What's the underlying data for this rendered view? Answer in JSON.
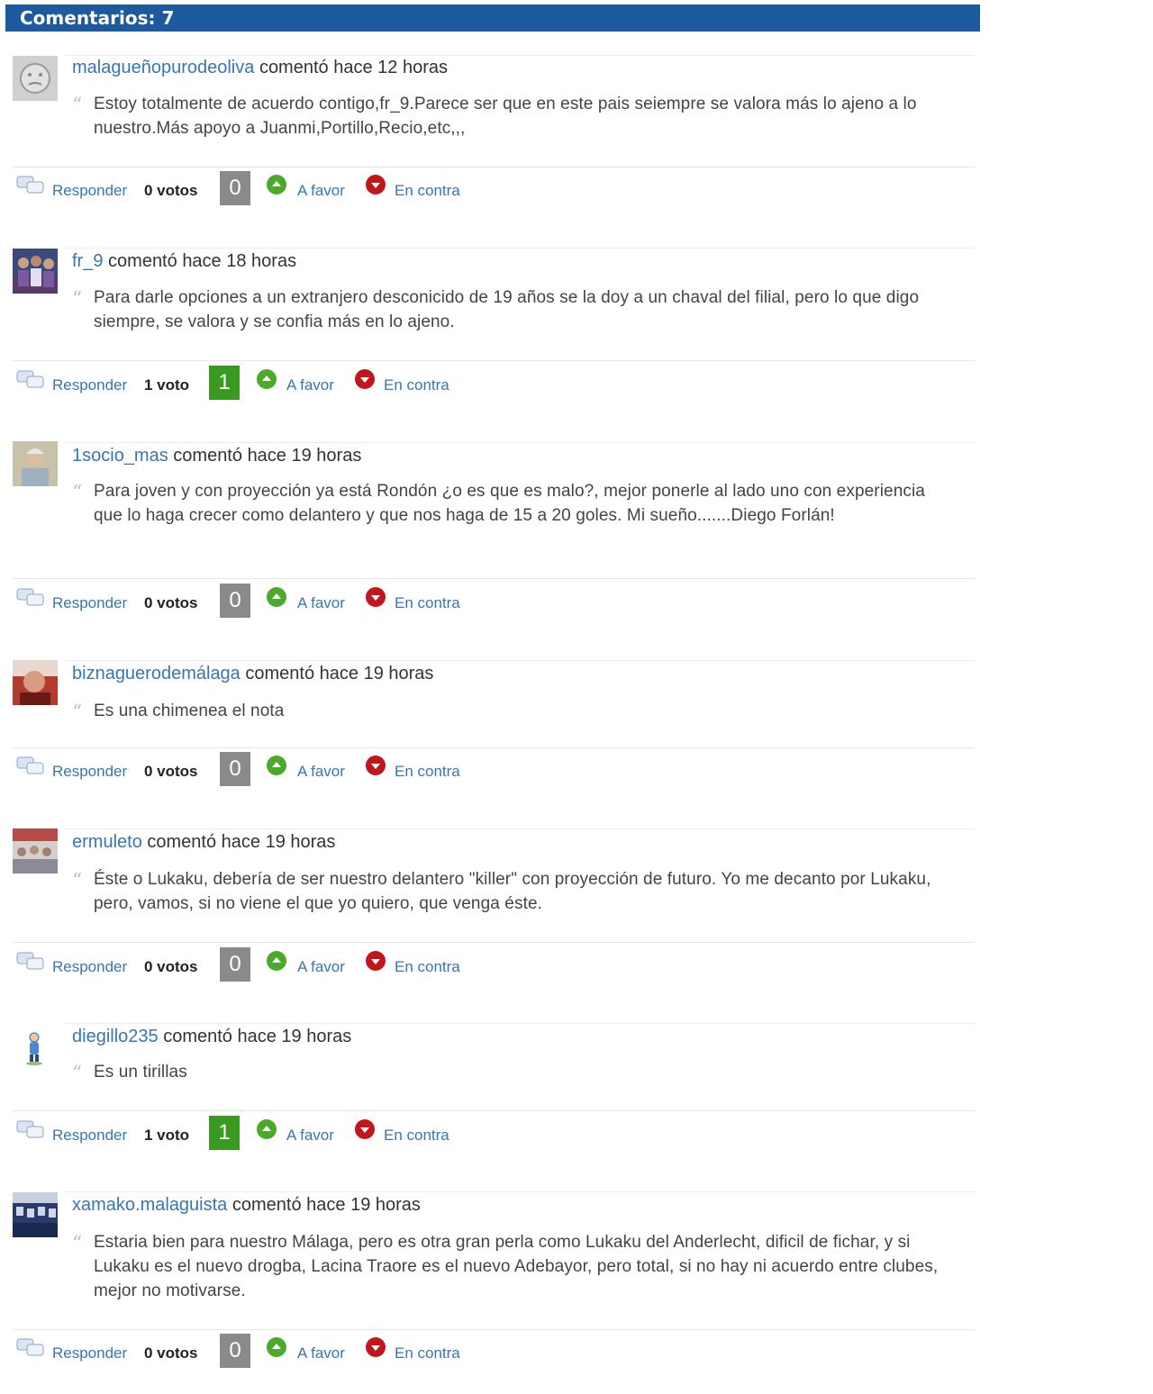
{
  "header": {
    "title": "Comentarios: 7"
  },
  "colors": {
    "header_bg": "#1b5a9e",
    "link": "#3776b5",
    "score_zero": "#8a8a8a",
    "score_positive": "#3a9a1f",
    "vote_favor": "#4caa2a",
    "vote_contra": "#c0161c"
  },
  "labels": {
    "commented": "comentó",
    "reply": "Responder",
    "favor": "A favor",
    "contra": "En contra"
  },
  "comments": [
    {
      "user": "malagueñopurodeoliva",
      "time": "hace 12 horas",
      "text": "Estoy totalmente de acuerdo contigo,fr_9.Parece ser que en este pais seiempre se valora más lo ajeno a lo nuestro.Más apoyo a Juanmi,Portillo,Recio,etc,,,",
      "votes_label": "0 votos",
      "score": "0",
      "avatar": "default-face-avatar"
    },
    {
      "user": "fr_9",
      "time": "hace 18 horas",
      "text": "Para darle opciones a un extranjero desconicido de 19 años se la doy a un chaval del filial, pero lo que digo siempre, se valora y se confia más en lo ajeno.",
      "votes_label": "1 voto",
      "score": "1",
      "avatar": "group-photo-avatar"
    },
    {
      "user": "1socio_mas",
      "time": "hace 19 horas",
      "text": "Para joven y con proyección ya está Rondón ¿o es que es malo?, mejor ponerle al lado uno con experiencia que lo haga crecer como delantero y que nos haga de 15 a 20 goles. Mi sueño.......Diego Forlán!",
      "votes_label": "0 votos",
      "score": "0",
      "avatar": "person-photo-avatar"
    },
    {
      "user": "biznaguerodemálaga",
      "time": "hace 19 horas",
      "text": "Es una chimenea el nota",
      "votes_label": "0 votos",
      "score": "0",
      "avatar": "red-photo-avatar"
    },
    {
      "user": "ermuleto",
      "time": "hace 19 horas",
      "text": "Éste o Lukaku, debería de ser nuestro delantero \"killer\" con proyección de futuro. Yo me decanto por Lukaku, pero, vamos, si no viene el que yo quiero, que venga éste.",
      "votes_label": "0 votos",
      "score": "0",
      "avatar": "crowd-photo-avatar"
    },
    {
      "user": "diegillo235",
      "time": "hace 19 horas",
      "text": "Es un tirillas",
      "votes_label": "1 voto",
      "score": "1",
      "avatar": "cartoon-figure-avatar"
    },
    {
      "user": "xamako.malaguista",
      "time": "hace 19 horas",
      "text": "Estaria bien para nuestro Málaga, pero es otra gran perla como Lukaku del Anderlecht, dificil de fichar, y si Lukaku es el nuevo drogba, Lacina Traore es el nuevo Adebayor, pero total, si no hay ni acuerdo entre clubes, mejor no motivarse.",
      "votes_label": "0 votos",
      "score": "0",
      "avatar": "stadium-photo-avatar"
    }
  ]
}
